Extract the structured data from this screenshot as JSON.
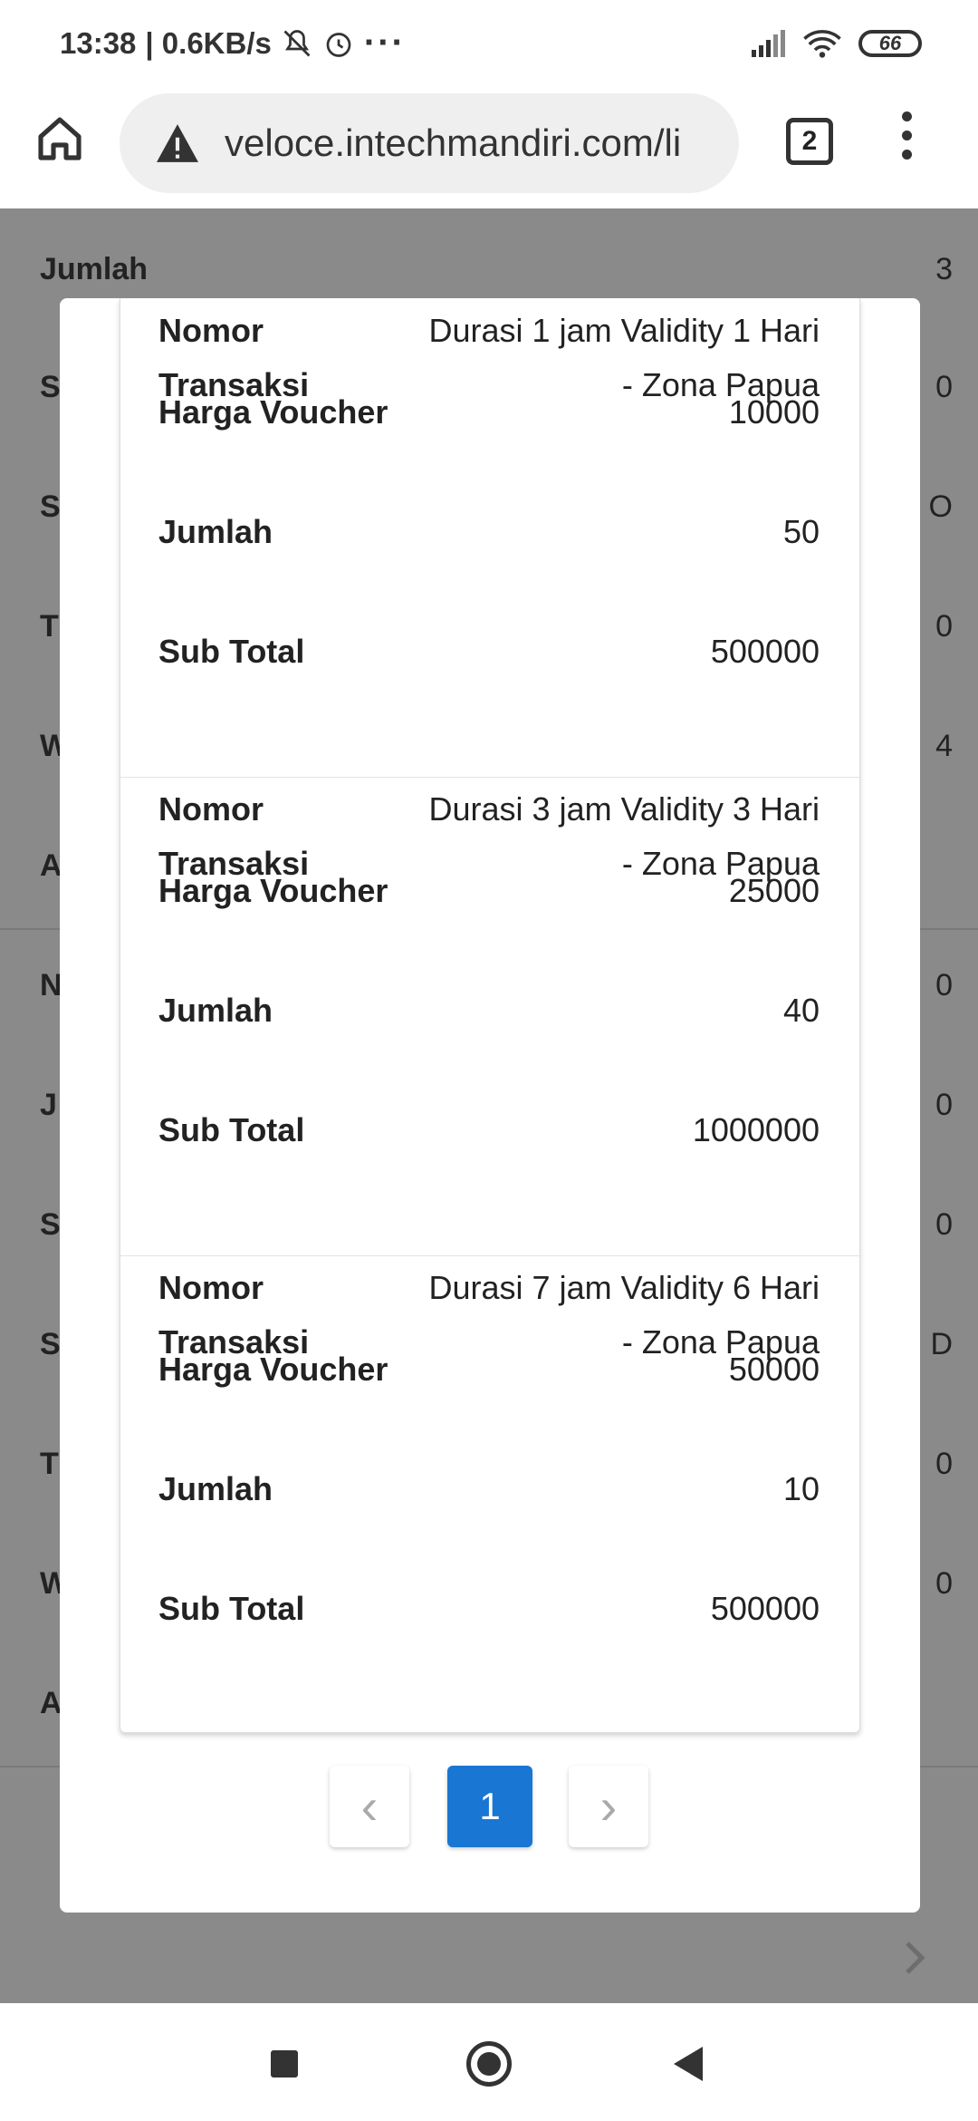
{
  "status": {
    "time": "13:38",
    "speed": "| 0.6KB/s",
    "icons": [
      "bell-off-icon",
      "alarm-icon",
      "more-dots-icon"
    ],
    "battery": "66"
  },
  "browser": {
    "url": "veloce.intechmandiri.com/li",
    "tab_count": "2"
  },
  "background": {
    "first_label": "Jumlah",
    "first_value": "3",
    "left_letters": [
      "S",
      "S",
      "T",
      "W",
      "A",
      "N",
      "J",
      "S",
      "S",
      "T",
      "W",
      "A"
    ],
    "right_values": [
      "0",
      "O",
      "0",
      "4",
      "",
      "0",
      "0",
      "0",
      "D",
      "0",
      "0",
      ""
    ]
  },
  "modal": {
    "entries": [
      {
        "nomor_label": "Nomor Transaksi",
        "nomor_value": "Durasi 1 jam Validity 1 Hari - Zona Papua",
        "harga_label": "Harga Voucher",
        "harga_value": "10000",
        "jumlah_label": "Jumlah",
        "jumlah_value": "50",
        "subtotal_label": "Sub Total",
        "subtotal_value": "500000"
      },
      {
        "nomor_label": "Nomor Transaksi",
        "nomor_value": "Durasi 3 jam Validity 3 Hari - Zona Papua",
        "harga_label": "Harga Voucher",
        "harga_value": "25000",
        "jumlah_label": "Jumlah",
        "jumlah_value": "40",
        "subtotal_label": "Sub Total",
        "subtotal_value": "1000000"
      },
      {
        "nomor_label": "Nomor Transaksi",
        "nomor_value": "Durasi 7 jam Validity 6 Hari - Zona Papua",
        "harga_label": "Harga Voucher",
        "harga_value": "50000",
        "jumlah_label": "Jumlah",
        "jumlah_value": "10",
        "subtotal_label": "Sub Total",
        "subtotal_value": "500000"
      }
    ],
    "pagination": {
      "prev": "‹",
      "current": "1",
      "next": "›"
    }
  },
  "colors": {
    "accent": "#1976d2",
    "backdrop": "#8a8a8a"
  }
}
